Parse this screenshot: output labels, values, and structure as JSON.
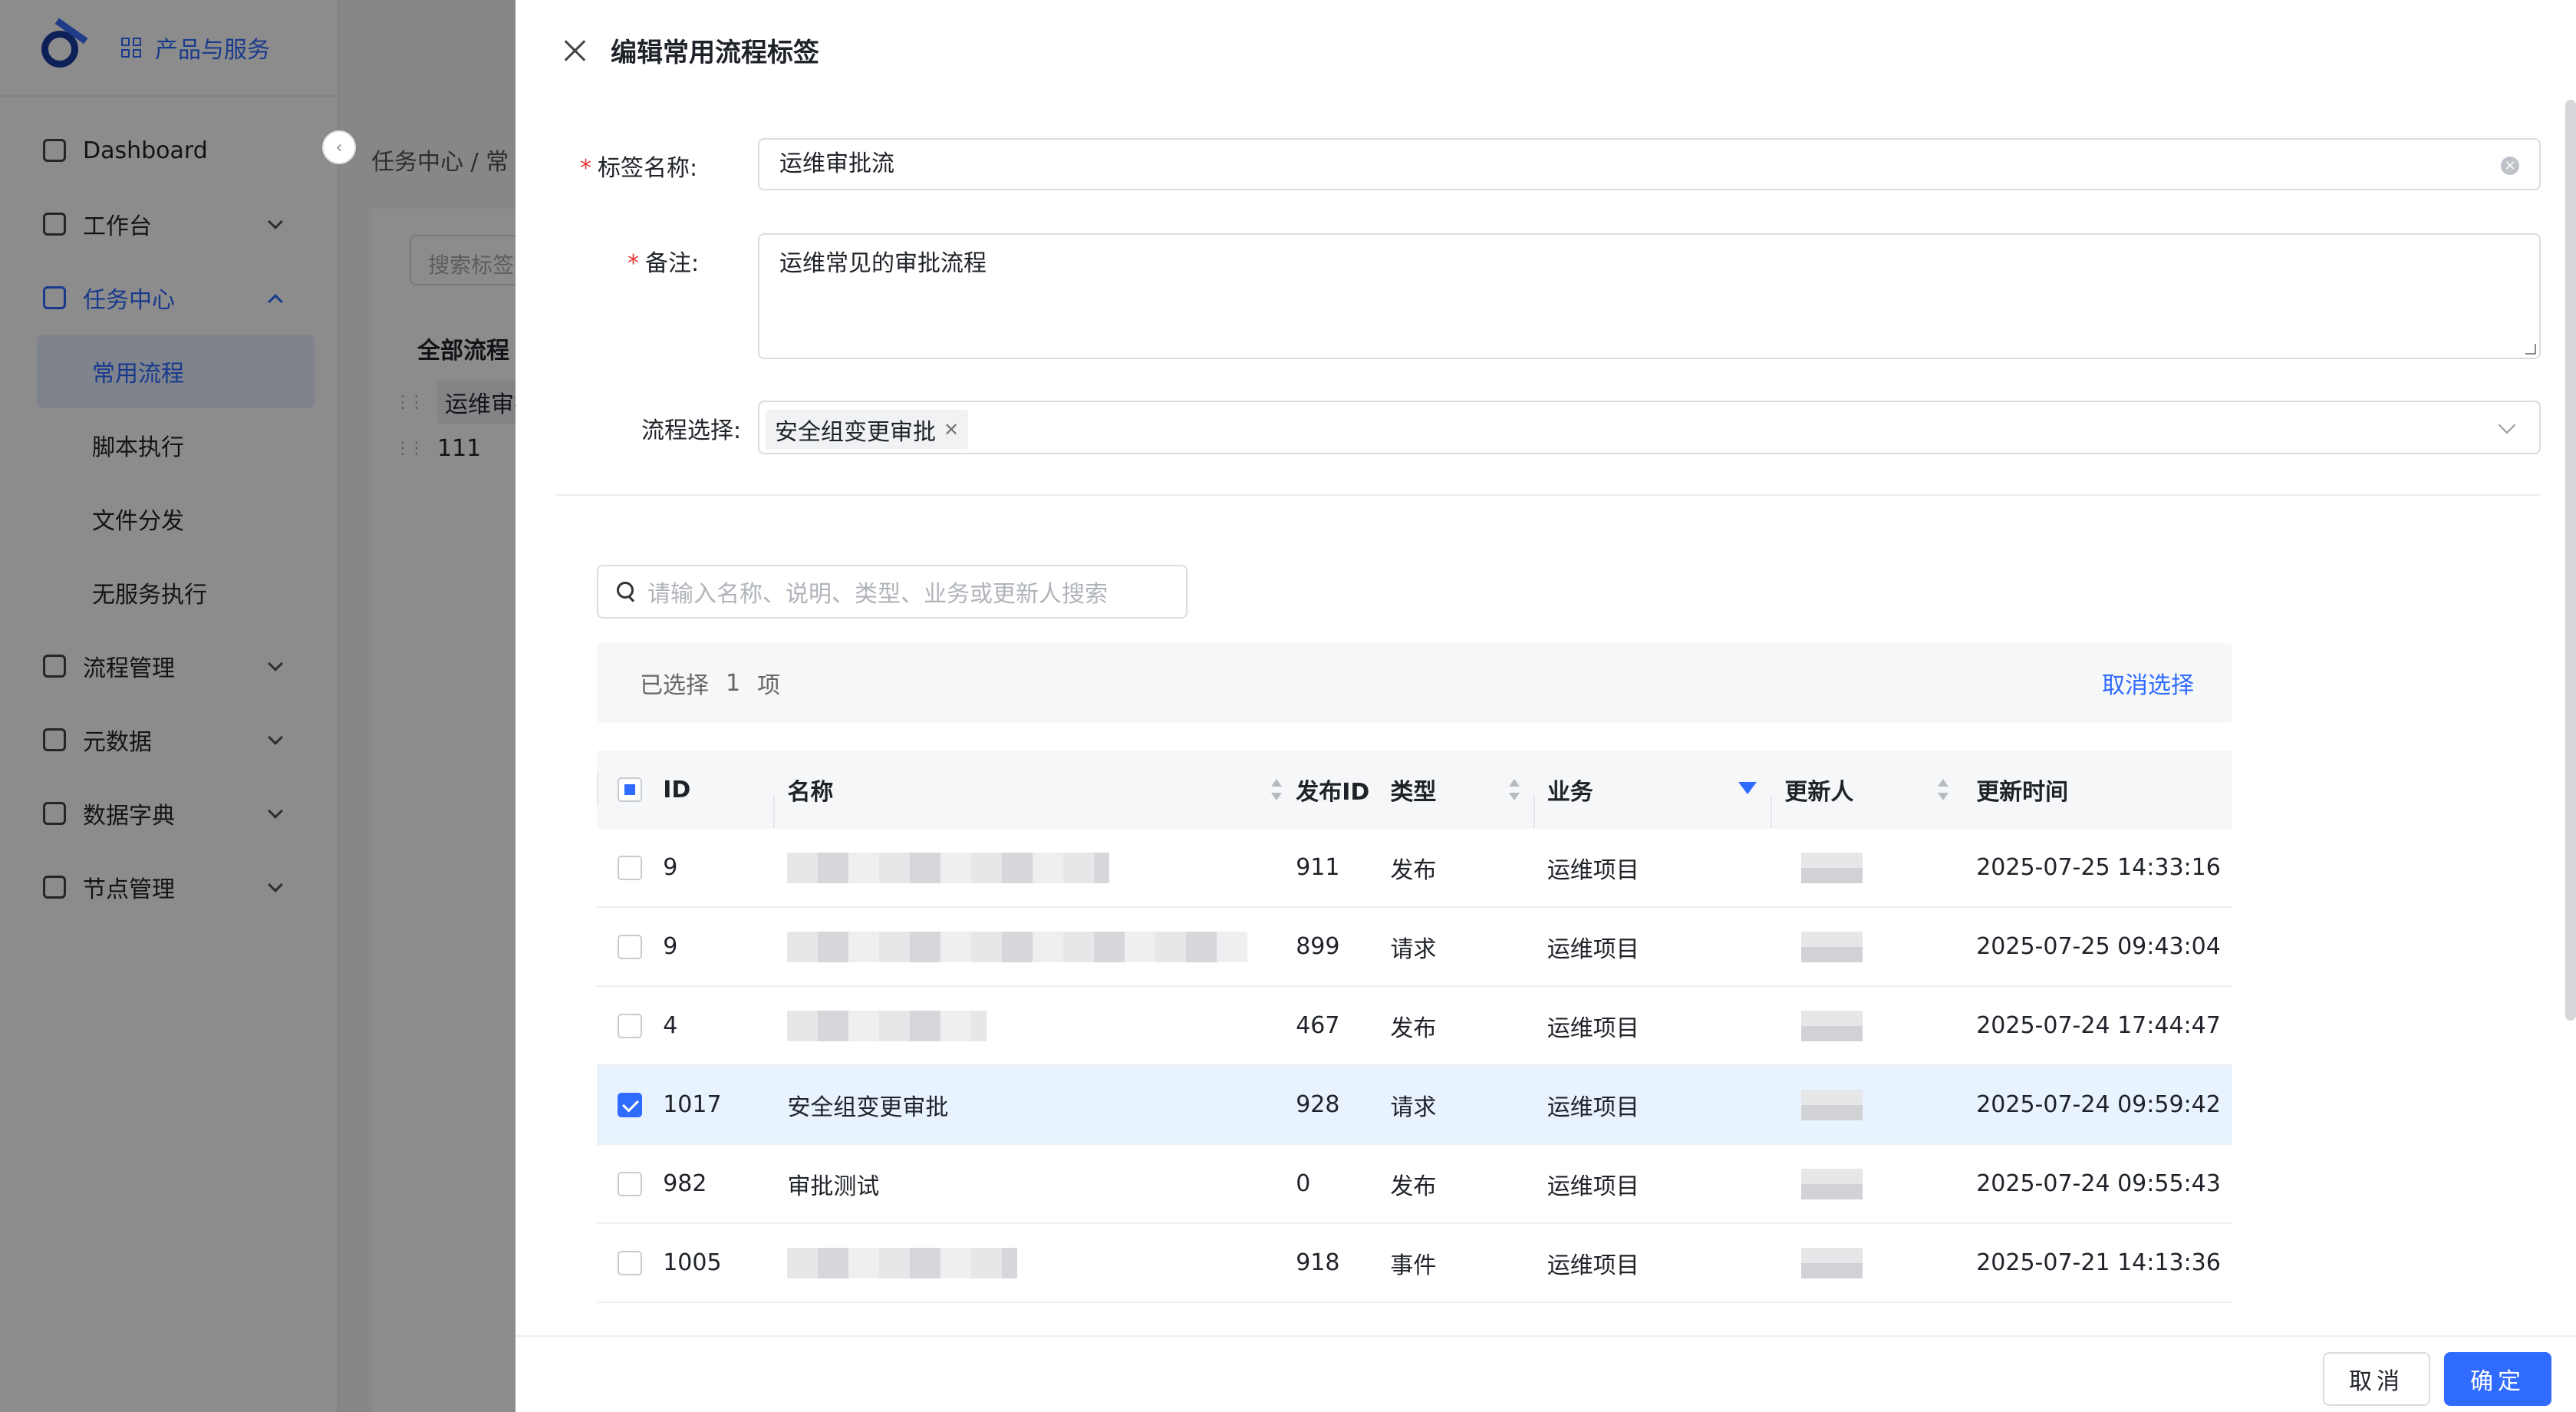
{
  "sidebar": {
    "product_label": "产品与服务",
    "items": [
      {
        "label": "Dashboard"
      },
      {
        "label": "工作台"
      },
      {
        "label": "任务中心"
      },
      {
        "label": "流程管理"
      },
      {
        "label": "元数据"
      },
      {
        "label": "数据字典"
      },
      {
        "label": "节点管理"
      }
    ],
    "sub_items": [
      "常用流程",
      "脚本执行",
      "文件分发",
      "无服务执行"
    ]
  },
  "background": {
    "breadcrumb": "任务中心  /  常",
    "search_placeholder": "搜索标签",
    "all_flows": "全部流程",
    "flow_tags": [
      "运维审批",
      "111"
    ]
  },
  "drawer": {
    "title": "编辑常用流程标签",
    "name_label": "标签名称:",
    "name_value": "运维审批流",
    "remark_label": "备注:",
    "remark_value": "运维常见的审批流程",
    "flow_label": "流程选择:",
    "selected_tag": "安全组变更审批",
    "search_placeholder": "请输入名称、说明、类型、业务或更新人搜索",
    "selected_prefix": "已选择",
    "selected_count": "1",
    "selected_suffix": "项",
    "cancel_selection": "取消选择",
    "cancel_btn": "取消",
    "ok_btn": "确定"
  },
  "table": {
    "headers": {
      "id": "ID",
      "name": "名称",
      "pid": "发布ID",
      "type": "类型",
      "biz": "业务",
      "updater": "更新人",
      "time": "更新时间"
    },
    "rows": [
      {
        "id": "9",
        "name": "",
        "pid": "911",
        "type": "发布",
        "biz": "运维项目",
        "time": "2025-07-25 14:33:16",
        "checked": false
      },
      {
        "id": "9",
        "name": "",
        "pid": "899",
        "type": "请求",
        "biz": "运维项目",
        "time": "2025-07-25 09:43:04",
        "checked": false
      },
      {
        "id": "4",
        "name": "",
        "pid": "467",
        "type": "发布",
        "biz": "运维项目",
        "time": "2025-07-24 17:44:47",
        "checked": false
      },
      {
        "id": "1017",
        "name": "安全组变更审批",
        "pid": "928",
        "type": "请求",
        "biz": "运维项目",
        "time": "2025-07-24 09:59:42",
        "checked": true
      },
      {
        "id": "982",
        "name": "审批测试",
        "pid": "0",
        "type": "发布",
        "biz": "运维项目",
        "time": "2025-07-24 09:55:43",
        "checked": false
      },
      {
        "id": "1005",
        "name": "",
        "pid": "918",
        "type": "事件",
        "biz": "运维项目",
        "time": "2025-07-21 14:13:36",
        "checked": false
      }
    ]
  }
}
